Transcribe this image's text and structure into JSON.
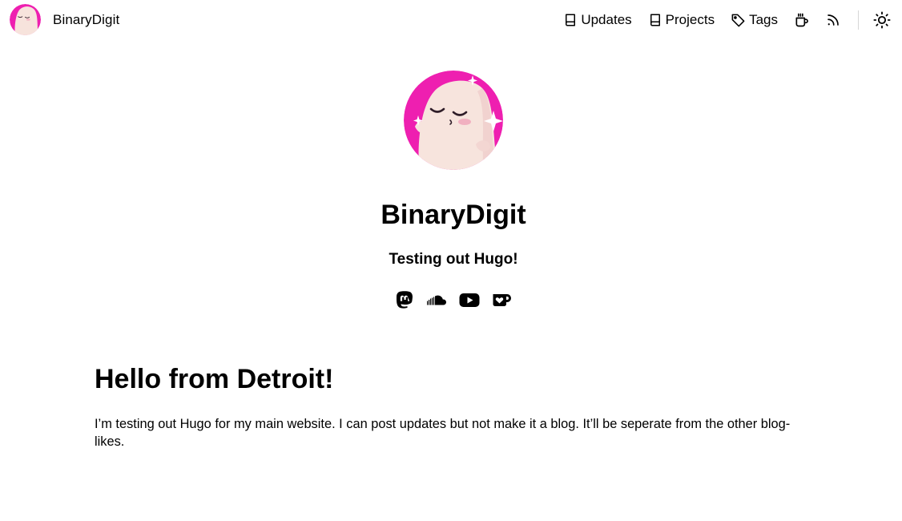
{
  "site": {
    "name": "BinaryDigit"
  },
  "nav": {
    "items": [
      {
        "label": "Updates",
        "icon": "book-icon"
      },
      {
        "label": "Projects",
        "icon": "book-icon"
      },
      {
        "label": "Tags",
        "icon": "tag-icon"
      },
      {
        "label": "",
        "icon": "coffee-cup-icon"
      },
      {
        "label": "",
        "icon": "rss-icon"
      }
    ],
    "theme_toggle_icon": "sun-icon"
  },
  "profile": {
    "title": "BinaryDigit",
    "subtitle": "Testing out Hugo!",
    "avatar_bg": "#ee1fb0",
    "social": [
      {
        "icon": "mastodon-icon"
      },
      {
        "icon": "soundcloud-icon"
      },
      {
        "icon": "youtube-icon"
      },
      {
        "icon": "kofi-icon"
      }
    ]
  },
  "post": {
    "title": "Hello from Detroit!",
    "body": "I’m testing out Hugo for my main website. I can post updates but not make it a blog. It’ll be seperate from the other blog-likes."
  }
}
